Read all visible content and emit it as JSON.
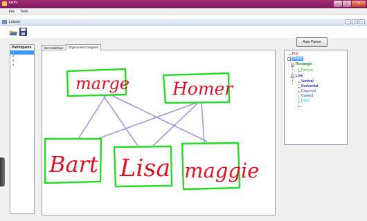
{
  "window": {
    "title": "Xanhi"
  },
  "menu": {
    "items": [
      "File",
      "Tools"
    ]
  },
  "child_window": {
    "title": "Lobster"
  },
  "participants": {
    "header": "Participants",
    "rows": [
      "1",
      "2",
      "3",
      "4"
    ],
    "selected_index": 0
  },
  "tabs": [
    {
      "label": "Item Interface",
      "active": false
    },
    {
      "label": "Organization Diagram",
      "active": true
    }
  ],
  "auto_parent_label": "Auto Parent",
  "diagram": {
    "boxes": [
      {
        "label": "marge"
      },
      {
        "label": "Homer"
      },
      {
        "label": "Bart"
      },
      {
        "label": "Lisa"
      },
      {
        "label": "maggie"
      }
    ],
    "ink_color": "#e21020",
    "box_color": "#22dd22",
    "link_color": "#9a9ae0"
  },
  "tree": {
    "items": [
      {
        "label": "Text",
        "color": "#e23030"
      },
      {
        "label": "Shape",
        "color": "#ffffff",
        "selected": true
      },
      {
        "label": "Rectangle",
        "color": "#1e8a2c"
      },
      {
        "label": "Person",
        "color": "#44dd44"
      },
      {
        "label": "Line",
        "color": "#1c2d96"
      },
      {
        "label": "Vertical",
        "color": "#2b2bd6"
      },
      {
        "label": "Horizontal",
        "color": "#2030b0"
      },
      {
        "label": "Diagonal",
        "color": "#7a7ae0"
      },
      {
        "label": "Curved",
        "color": "#3e7ed8"
      },
      {
        "label": "Other",
        "color": "#33ddee"
      }
    ]
  }
}
